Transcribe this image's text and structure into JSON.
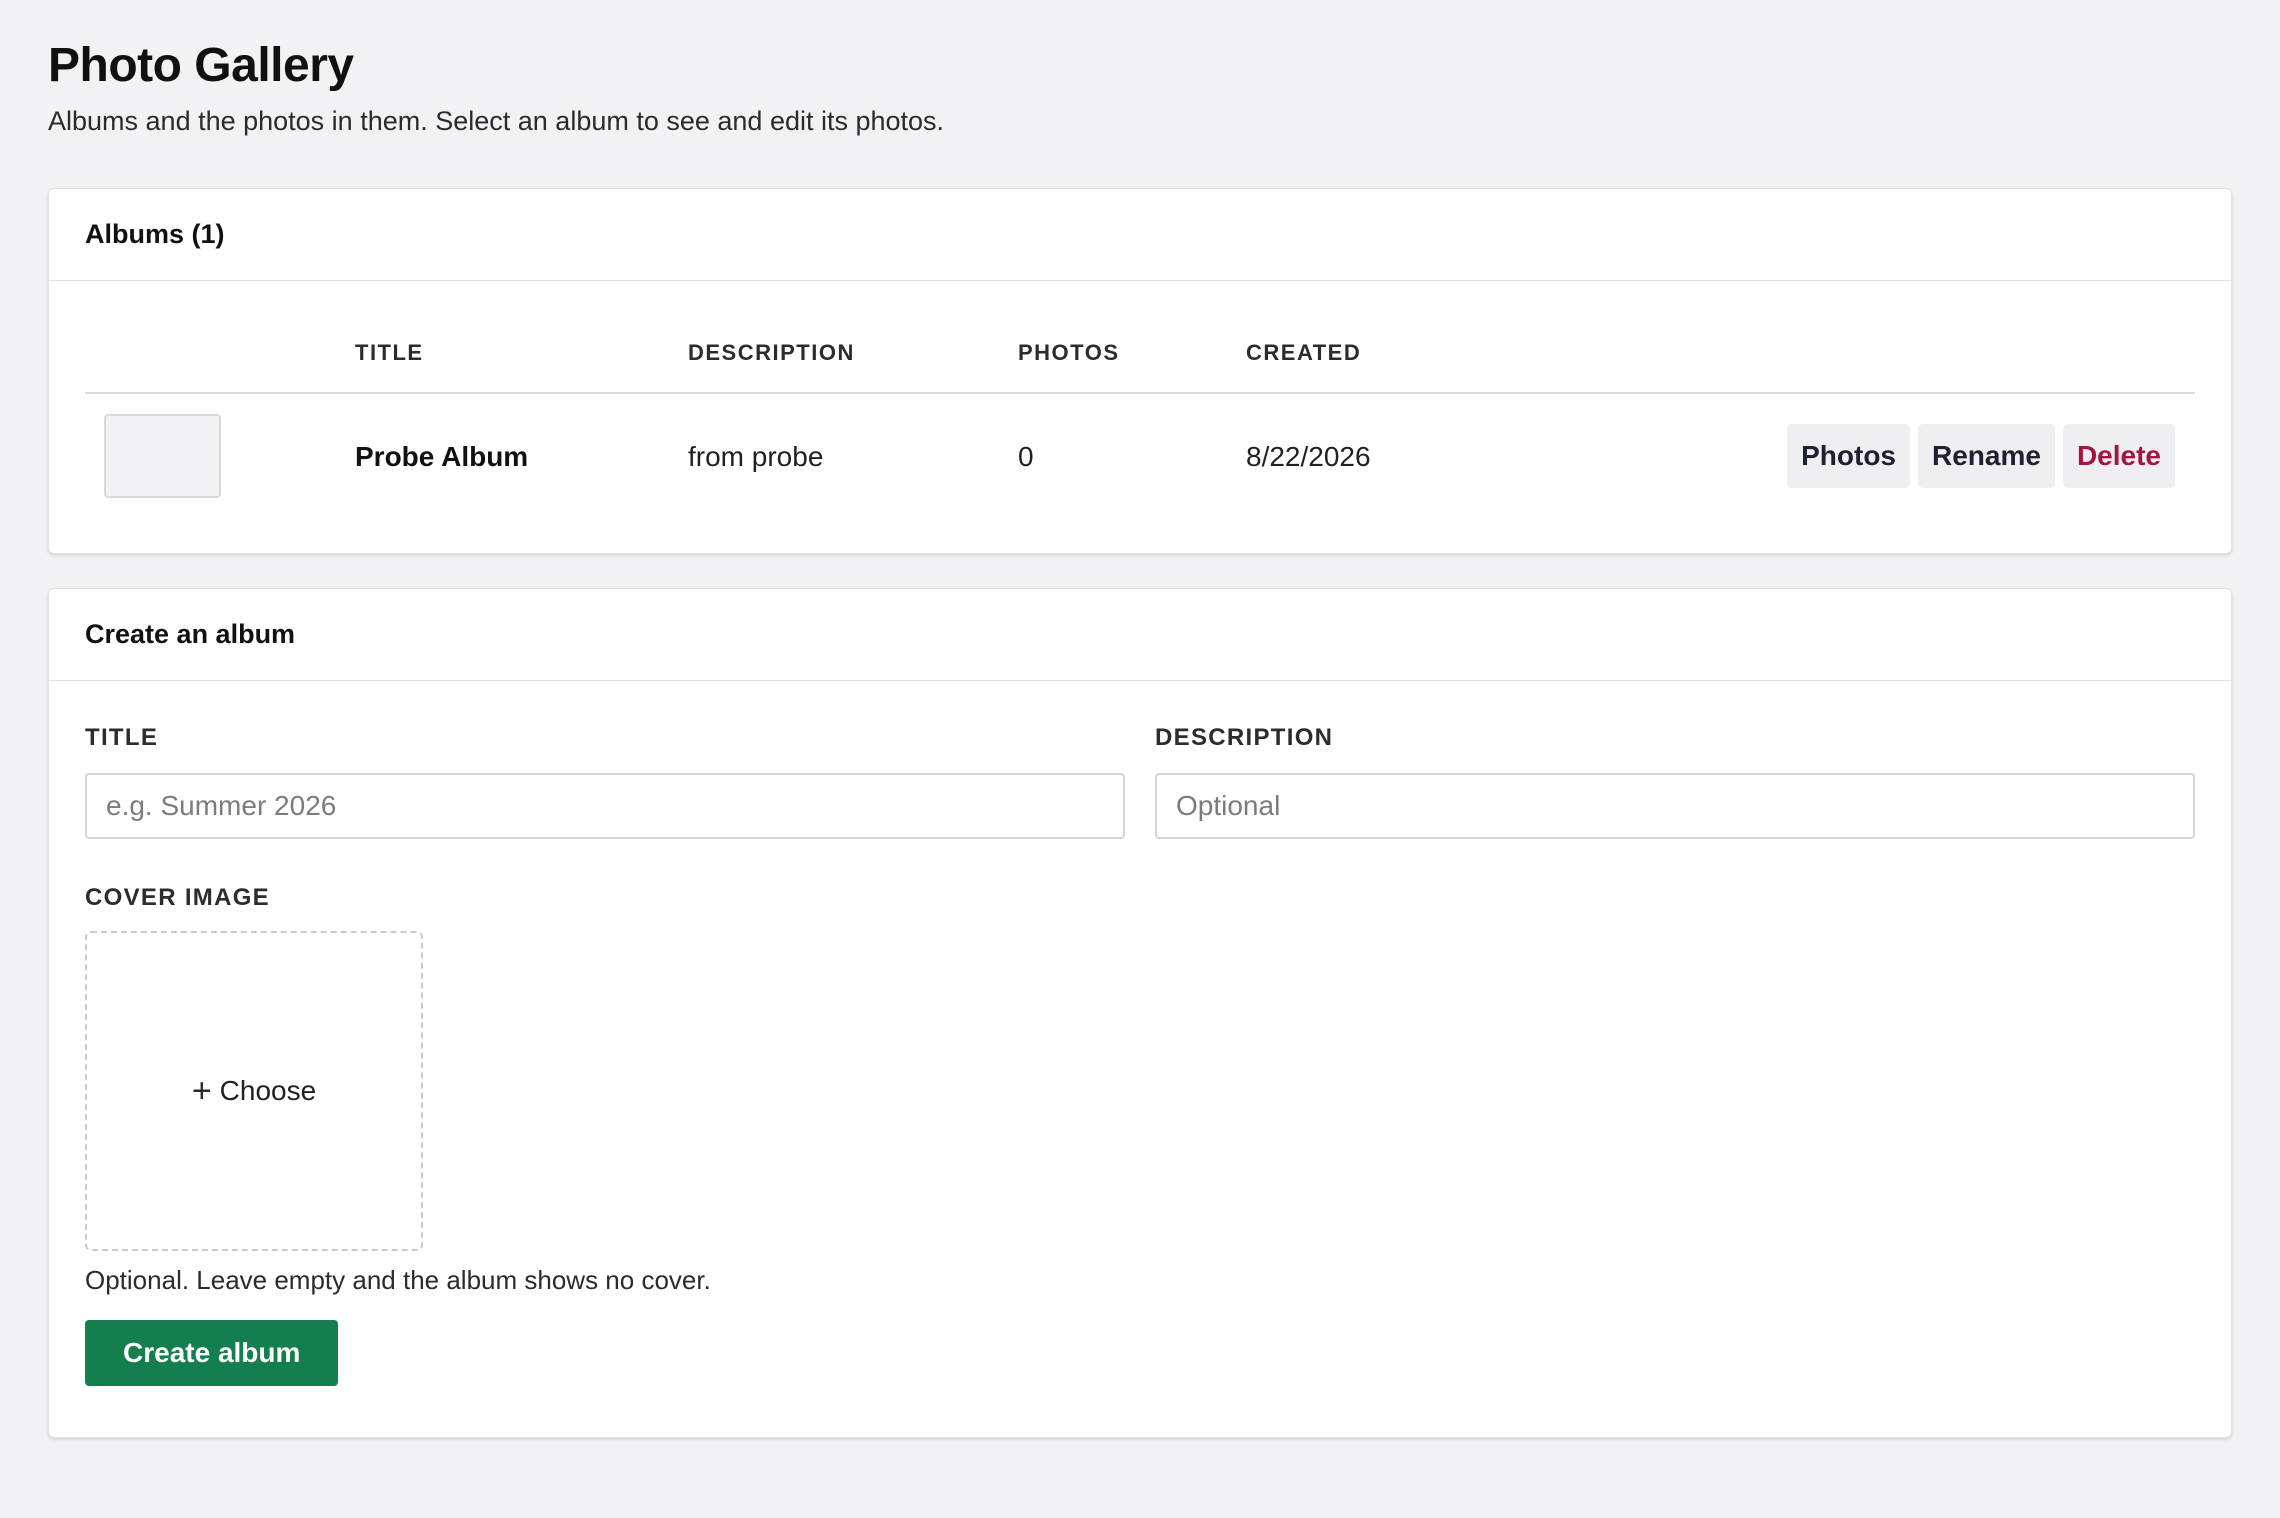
{
  "page": {
    "title": "Photo Gallery",
    "subtitle": "Albums and the photos in them. Select an album to see and edit its photos."
  },
  "albums": {
    "header": "Albums (1)",
    "columns": {
      "title": "TITLE",
      "description": "DESCRIPTION",
      "photos": "PHOTOS",
      "created": "CREATED"
    },
    "rows": [
      {
        "title": "Probe Album",
        "description": "from probe",
        "photos": "0",
        "created": "8/22/2026",
        "actions": {
          "photos": "Photos",
          "rename": "Rename",
          "delete": "Delete"
        }
      }
    ]
  },
  "create": {
    "header": "Create an album",
    "title_label": "TITLE",
    "title_placeholder": "e.g. Summer 2026",
    "title_value": "",
    "description_label": "DESCRIPTION",
    "description_placeholder": "Optional",
    "description_value": "",
    "cover_label": "COVER IMAGE",
    "choose_icon": "plus-icon",
    "choose_label": "Choose",
    "cover_help": "Optional. Leave empty and the album shows no cover.",
    "submit_label": "Create album"
  },
  "colors": {
    "background": "#f2f2f4",
    "primary": "#137f4f",
    "danger": "#a3173f"
  }
}
